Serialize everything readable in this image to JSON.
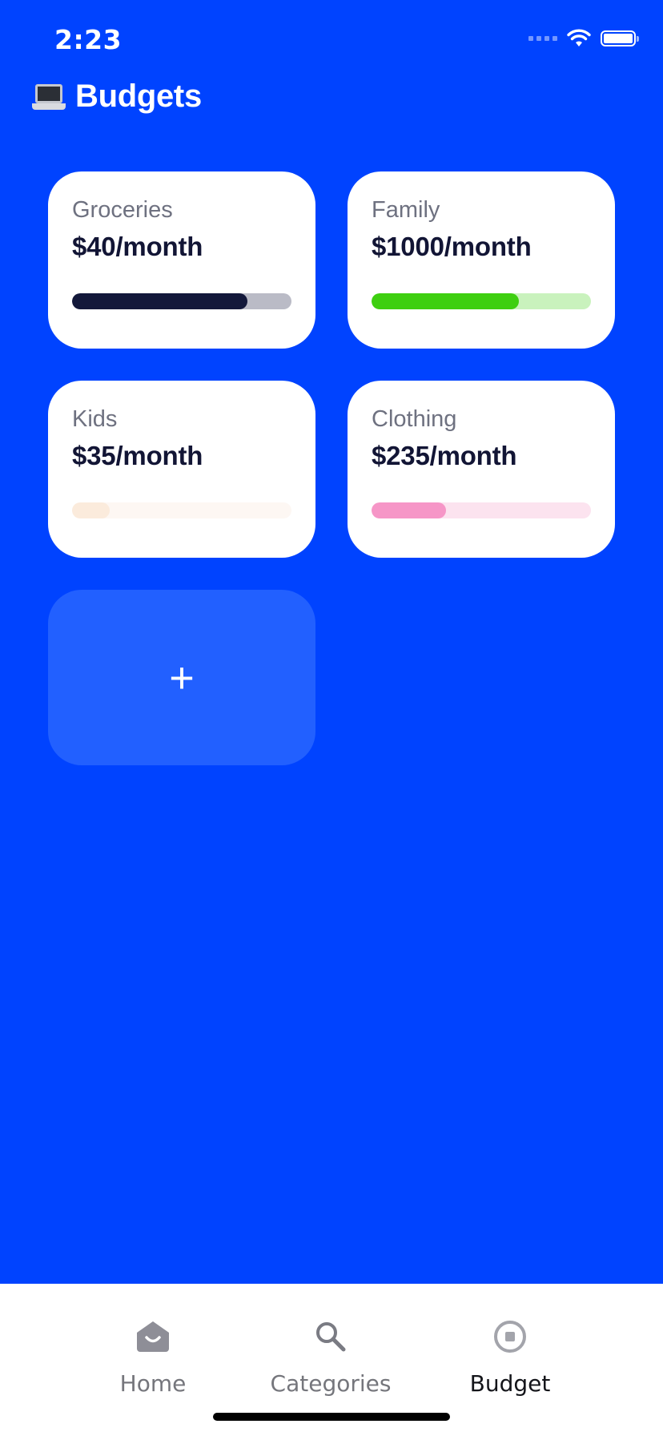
{
  "status": {
    "time": "2:23"
  },
  "header": {
    "icon": "laptop-icon",
    "title": "Budgets"
  },
  "budgets": [
    {
      "name": "Groceries",
      "amount": "$40/month",
      "progress": 0.8,
      "fill_color": "#13183A",
      "track_color": "#BABBC6"
    },
    {
      "name": "Family",
      "amount": "$1000/month",
      "progress": 0.67,
      "fill_color": "#3ECF10",
      "track_color": "#C9F2BD"
    },
    {
      "name": "Kids",
      "amount": "$35/month",
      "progress": 0.17,
      "fill_color": "#FBEBDC",
      "track_color": "#FDF7F3"
    },
    {
      "name": "Clothing",
      "amount": "$235/month",
      "progress": 0.34,
      "fill_color": "#F696C7",
      "track_color": "#FCE3EF"
    }
  ],
  "add_button": {
    "label": "+"
  },
  "tabs": [
    {
      "label": "Home",
      "icon": "home-icon",
      "active": false
    },
    {
      "label": "Categories",
      "icon": "search-icon",
      "active": false
    },
    {
      "label": "Budget",
      "icon": "budget-icon",
      "active": true
    }
  ],
  "colors": {
    "background": "#0043FF",
    "add_card": "#2260FF"
  }
}
